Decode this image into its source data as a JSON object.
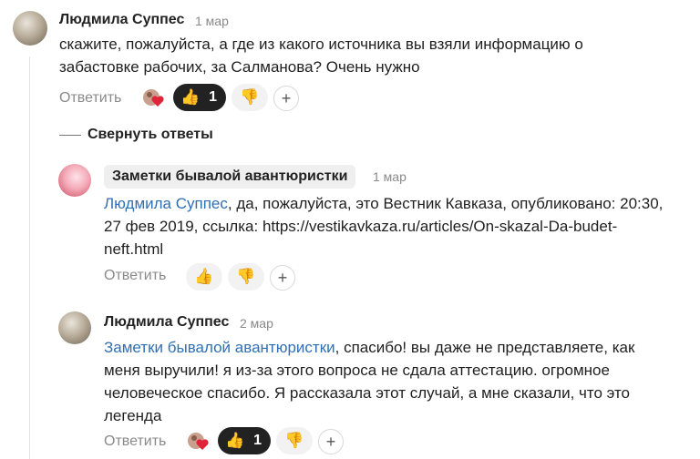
{
  "comments": [
    {
      "author": "Людмила Суппес",
      "date": "1 мар",
      "text": "скажите, пожалуйста, а где из какого источника вы взяли информацию о забастовке рабочих, за Салманова? Очень нужно",
      "reply_label": "Ответить",
      "like_count": "1"
    },
    {
      "author": "Заметки бывалой авантюристки",
      "date": "1 мар",
      "mention": "Людмила Суппес",
      "text": ", да, пожалуйста, это Вестник Кавказа, опубликовано: 20:30, 27 фев 2019, ссылка: https://vestikavkaza.ru/articles/On-skazal-Da-budet-neft.html",
      "reply_label": "Ответить"
    },
    {
      "author": "Людмила Суппес",
      "date": "2 мар",
      "mention": "Заметки бывалой авантюристки",
      "text": ", спасибо! вы даже не представляете, как меня выручили! я из-за этого вопроса не сдала аттестацию. огромное человеческое спасибо. Я рассказала этот случай, а мне сказали, что это легенда",
      "reply_label": "Ответить",
      "like_count": "1"
    }
  ],
  "collapse_label": "Свернуть ответы",
  "icons": {
    "like": "thumbs-up-icon",
    "dislike": "thumbs-down-icon",
    "add_reaction": "plus-icon",
    "heart_reaction": "heart-avatar-icon"
  },
  "colors": {
    "mention": "#2f6fb5",
    "thumb": "#f5b400",
    "dark_pill": "#222222"
  }
}
